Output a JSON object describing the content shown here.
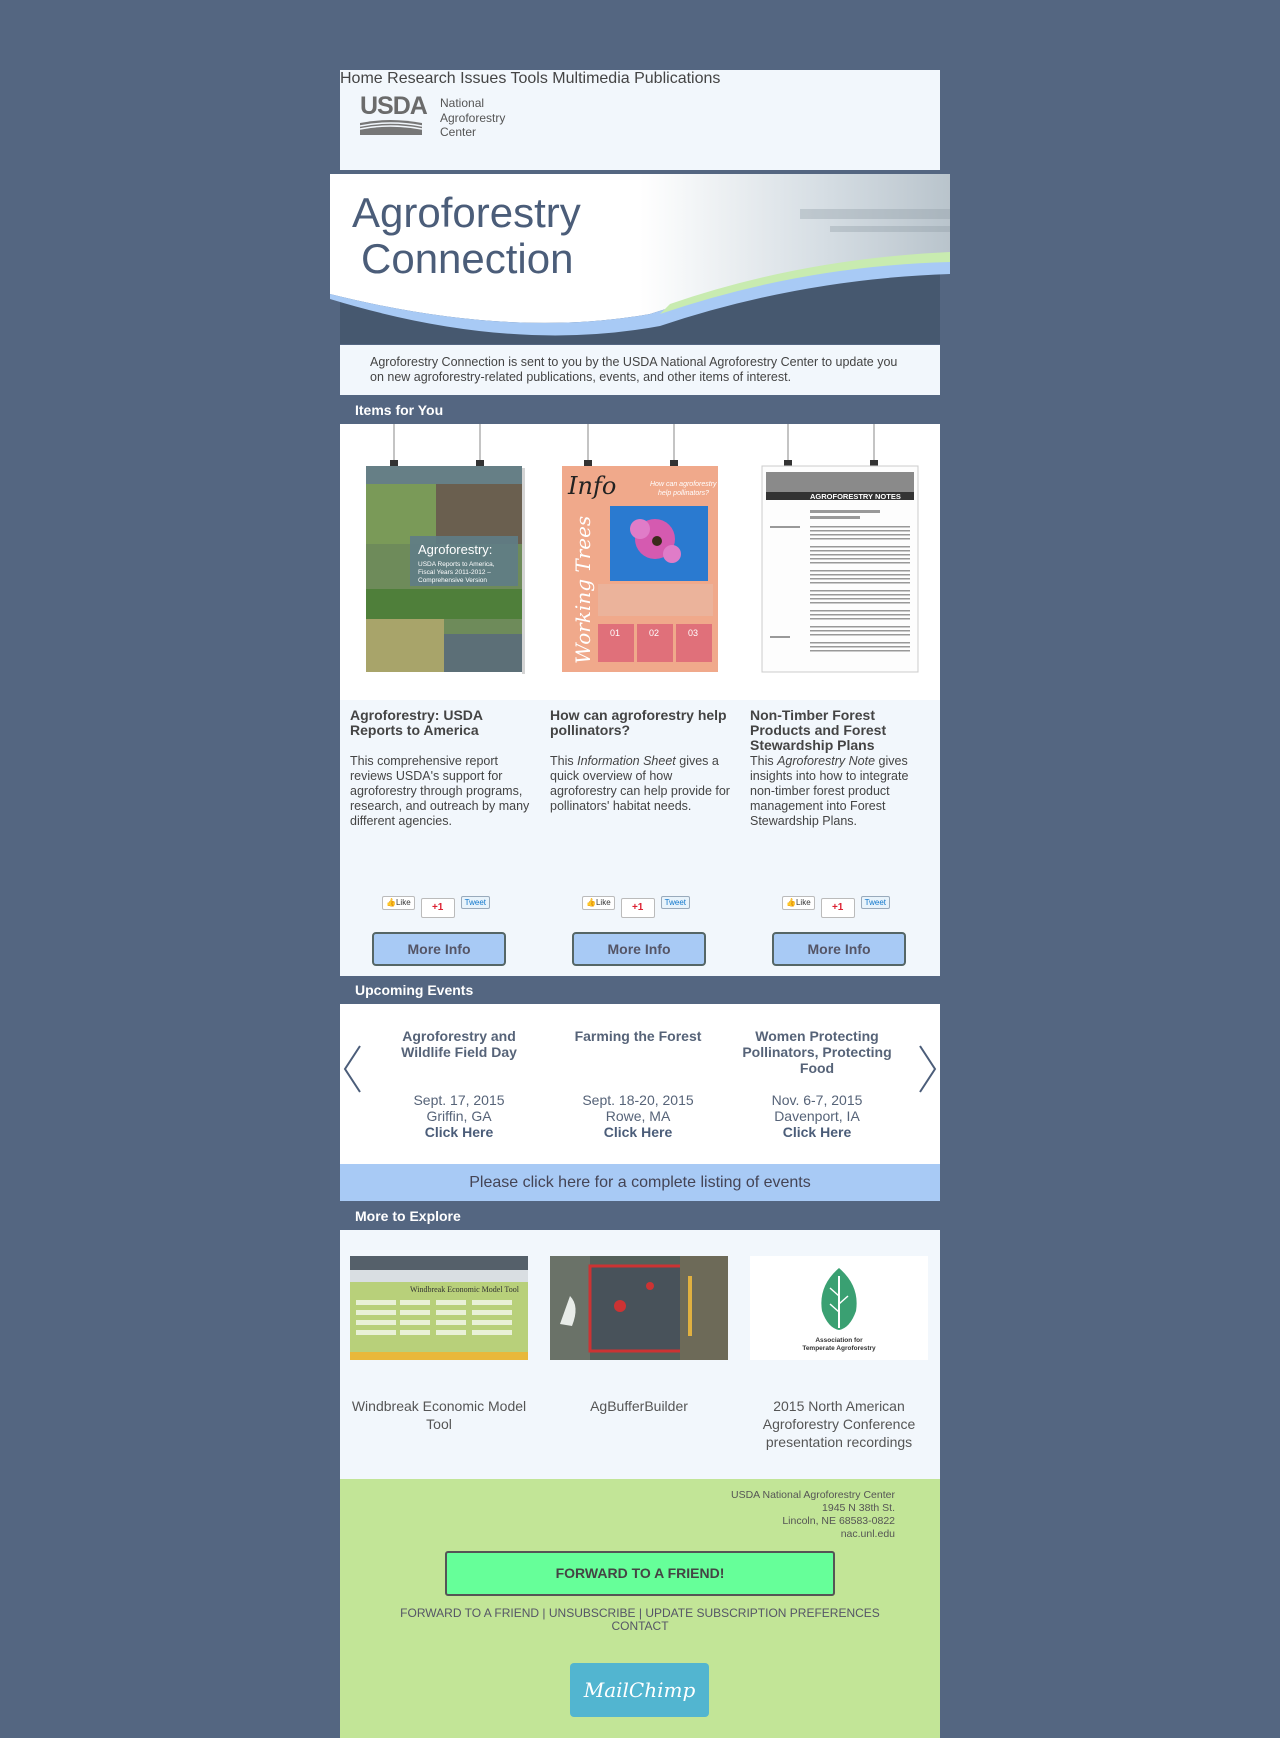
{
  "header": {
    "logo_text": "USDA",
    "org_lines": [
      "National",
      "Agroforestry",
      "Center"
    ]
  },
  "nav": {
    "items": [
      "Home",
      "Research",
      "Issues",
      "Tools",
      "Multimedia",
      "Publications"
    ]
  },
  "banner": {
    "title_line1": "Agroforestry",
    "title_line2": "Connection"
  },
  "intro": {
    "text": "Agroforestry Connection is sent to you by the USDA National Agroforestry Center to update you on new agroforestry-related publications, events, and other items of interest."
  },
  "items_section": {
    "heading": "Items for You",
    "items": [
      {
        "cover_title": "Agroforestry:",
        "cover_sub": "USDA Reports to America, Fiscal Years 2011-2012 – Comprehensive Version",
        "title": "Agroforestry: USDA Reports to America",
        "desc": "This comprehensive report reviews USDA's support for agroforestry through programs, research, and outreach by many different agencies.",
        "button": "More Info"
      },
      {
        "cover_title": "Info",
        "cover_side": "Working Trees",
        "cover_q": "How can agroforestry help pollinators?",
        "cover_nums": [
          "01",
          "02",
          "03"
        ],
        "title": "How can agroforestry help pollinators?",
        "desc_pre": "This ",
        "desc_em": "Information Sheet",
        "desc_post": " gives a quick overview of how agroforestry can help provide for pollinators' habitat needs.",
        "button": "More Info"
      },
      {
        "cover_title": "AGROFORESTRY NOTES",
        "title": "Non-Timber Forest Products and Forest Stewardship Plans",
        "desc_pre": "This ",
        "desc_em": "Agroforestry Note",
        "desc_post": " gives insights into how to integrate non-timber forest product management into Forest Stewardship Plans.",
        "button": "More Info"
      }
    ],
    "social": {
      "like": "Like",
      "plus": "+1",
      "tweet": "Tweet"
    }
  },
  "events_section": {
    "heading": "Upcoming Events",
    "events": [
      {
        "title": "Agroforestry and Wildlife Field Day",
        "date": "Sept. 17, 2015",
        "place": "Griffin, GA",
        "link": "Click Here"
      },
      {
        "title": "Farming the Forest",
        "date": "Sept. 18-20, 2015",
        "place": "Rowe, MA",
        "link": "Click Here"
      },
      {
        "title": "Women Protecting Pollinators, Protecting Food",
        "date": "Nov. 6-7, 2015",
        "place": "Davenport, IA",
        "link": "Click Here"
      }
    ],
    "all_link": "Please click here for a complete listing of events"
  },
  "explore_section": {
    "heading": "More to Explore",
    "items": [
      {
        "caption": "Windbreak Economic Model Tool",
        "img_title": "Windbreak Economic Model Tool"
      },
      {
        "caption": "AgBufferBuilder"
      },
      {
        "caption": "2015 North American Agroforestry Conference presentation recordings",
        "logo_text_1": "Association for",
        "logo_text_2": "Temperate Agroforestry"
      }
    ]
  },
  "footer": {
    "address": [
      "USDA National Agroforestry Center",
      "1945 N 38th St.",
      "Lincoln, NE 68583-0822",
      "nac.unl.edu"
    ],
    "forward_button": "FORWARD TO A FRIEND!",
    "links_line1": "FORWARD TO A FRIEND | UNSUBSCRIBE | UPDATE SUBSCRIPTION PREFERENCES",
    "links_line2": "CONTACT",
    "mailchimp": "MailChimp"
  },
  "colors": {
    "page_bg": "#546681",
    "panel_bg": "#f2f7fc",
    "accent_blue": "#a8caf5",
    "footer_green": "#c2e597",
    "forward_green": "#66ff99"
  }
}
